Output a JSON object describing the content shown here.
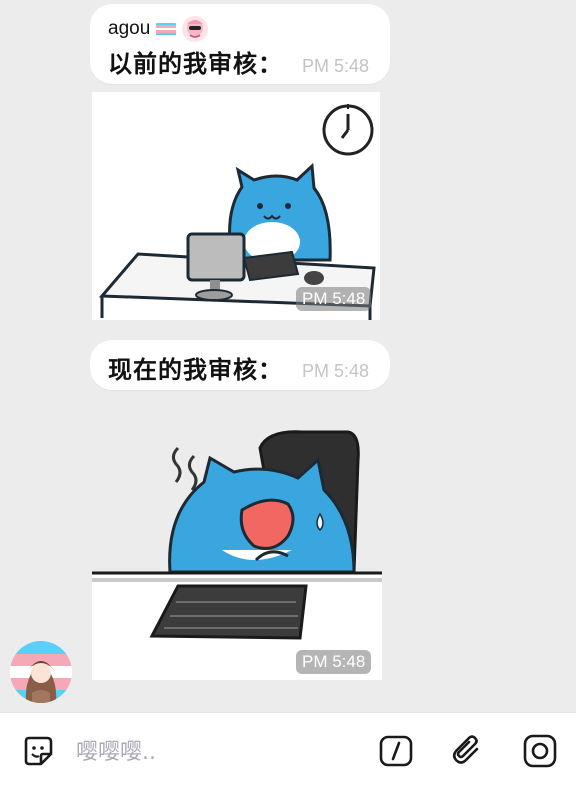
{
  "messages": [
    {
      "sender": "agou",
      "text": "以前的我审核：",
      "time": "PM 5:48"
    },
    {
      "type": "image",
      "description_icon": "cat-at-desk-sticker",
      "time": "PM 5:48"
    },
    {
      "text": "现在的我审核：",
      "time": "PM 5:48"
    },
    {
      "type": "image",
      "description_icon": "tired-cat-sticker",
      "time": "PM 5:48"
    }
  ],
  "composer": {
    "placeholder": "嘤嘤嘤.."
  },
  "icons": {
    "sticker": "sticker-icon",
    "command": "slash-command-icon",
    "attach": "paperclip-icon",
    "camera": "camera-icon",
    "trans_flag": "trans-flag-icon"
  },
  "colors": {
    "background": "#ececed",
    "bubble": "#ffffff",
    "time": "#c4c4c4",
    "cat_blue": "#3aa6df",
    "icon": "#1a1a1a",
    "placeholder": "#a9aab7"
  }
}
